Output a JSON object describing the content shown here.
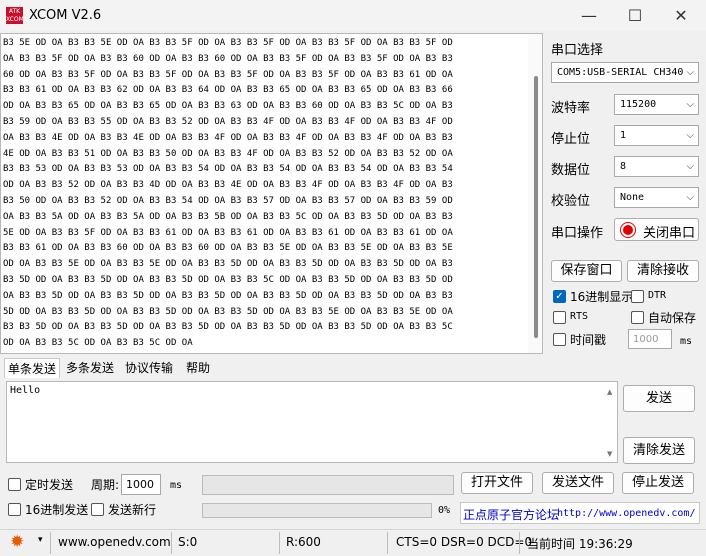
{
  "window": {
    "logo_text": "ATK XCOM",
    "title": "XCOM V2.6",
    "minimize": "—",
    "maximize": "☐",
    "close": "✕"
  },
  "receive": {
    "lines": [
      "B3 5E OD OA B3 B3 5E OD OA B3 B3 5F OD OA B3 B3 5F OD OA B3 B3 5F OD OA B3 B3 5F OD",
      "OA B3 B3 5F OD OA B3 B3 60 OD OA B3 B3 60 OD OA B3 B3 5F OD OA B3 B3 5F OD OA B3 B3",
      "60 OD OA B3 B3 5F OD OA B3 B3 5F OD OA B3 B3 5F OD OA B3 B3 5F OD OA B3 B3 61 OD OA",
      "B3 B3 61 OD OA B3 B3 62 OD OA B3 B3 64 OD OA B3 B3 65 OD OA B3 B3 65 OD OA B3 B3 66",
      "OD OA B3 B3 65 OD OA B3 B3 65 OD OA B3 B3 63 OD OA B3 B3 60 OD OA B3 B3 5C OD OA B3",
      "B3 59 OD OA B3 B3 55 OD OA B3 B3 52 OD OA B3 B3 4F OD OA B3 B3 4F OD OA B3 B3 4F OD",
      "OA B3 B3 4E OD OA B3 B3 4E OD OA B3 B3 4F OD OA B3 B3 4F OD OA B3 B3 4F OD OA B3 B3",
      "4E OD OA B3 B3 51 OD OA B3 B3 50 OD OA B3 B3 4F OD OA B3 B3 52 OD OA B3 B3 52 OD OA",
      "B3 B3 53 OD OA B3 B3 53 OD OA B3 B3 54 OD OA B3 B3 54 OD OA B3 B3 54 OD OA B3 B3 54",
      "OD OA B3 B3 52 OD OA B3 B3 4D OD OA B3 B3 4E OD OA B3 B3 4F OD OA B3 B3 4F OD OA B3",
      "B3 50 OD OA B3 B3 52 OD OA B3 B3 54 OD OA B3 B3 57 OD OA B3 B3 57 OD OA B3 B3 59 OD",
      "OA B3 B3 5A OD OA B3 B3 5A OD OA B3 B3 5B OD OA B3 B3 5C OD OA B3 B3 5D OD OA B3 B3",
      "5E OD OA B3 B3 5F OD OA B3 B3 61 OD OA B3 B3 61 OD OA B3 B3 61 OD OA B3 B3 61 OD OA",
      "B3 B3 61 OD OA B3 B3 60 OD OA B3 B3 60 OD OA B3 B3 5E OD OA B3 B3 5E OD OA B3 B3 5E",
      "OD OA B3 B3 5E OD OA B3 B3 5E OD OA B3 B3 5D OD OA B3 B3 5D OD OA B3 B3 5D OD OA B3",
      "B3 5D OD OA B3 B3 5D OD OA B3 B3 5D OD OA B3 B3 5C OD OA B3 B3 5D OD OA B3 B3 5D OD",
      "OA B3 B3 5D OD OA B3 B3 5D OD OA B3 B3 5D OD OA B3 B3 5D OD OA B3 B3 5D OD OA B3 B3",
      "5D OD OA B3 B3 5D OD OA B3 B3 5D OD OA B3 B3 5D OD OA B3 B3 5E OD OA B3 B3 5E OD OA",
      "B3 B3 5D OD OA B3 B3 5D OD OA B3 B3 5D OD OA B3 B3 5D OD OA B3 B3 5D OD OA B3 B3 5C",
      "OD OA B3 B3 5C OD OA B3 B3 5C OD OA"
    ]
  },
  "settings": {
    "port_label": "串口选择",
    "port_value": "COM5:USB-SERIAL CH340",
    "baud_label": "波特率",
    "baud_value": "115200",
    "stop_label": "停止位",
    "stop_value": "1",
    "data_label": "数据位",
    "data_value": "8",
    "parity_label": "校验位",
    "parity_value": "None",
    "op_label": "串口操作",
    "close_port": "关闭串口",
    "save_window": "保存窗口",
    "clear_receive": "清除接收",
    "hex_display": "16进制显示",
    "dtr": "DTR",
    "rts": "RTS",
    "auto_save": "自动保存",
    "timestamp": "时间戳",
    "timestamp_ms": "1000",
    "ms": "ms"
  },
  "tabs": [
    "单条发送",
    "多条发送",
    "协议传输",
    "帮助"
  ],
  "send": {
    "text": "Hello",
    "send_button": "发送",
    "clear_send": "清除发送",
    "timed_send": "定时发送",
    "period_label": "周期:",
    "period_value": "1000",
    "ms": "ms",
    "open_file": "打开文件",
    "send_file": "发送文件",
    "stop_send": "停止发送",
    "hex_send": "16进制发送",
    "send_newline": "发送新行",
    "progress_text": "0%",
    "progress": 0,
    "forum_text": "正点原子官方论坛",
    "forum_url": "http://www.openedv.com/"
  },
  "status": {
    "website": "www.openedv.com",
    "sent": "S:0",
    "received": "R:600",
    "signals": "CTS=0 DSR=0 DCD=0",
    "time": "当前时间 19:36:29"
  },
  "colors": {
    "close_port_icon": "#e00000",
    "checkbox_on": "#0067c0",
    "forum_link": "#0000cc"
  }
}
